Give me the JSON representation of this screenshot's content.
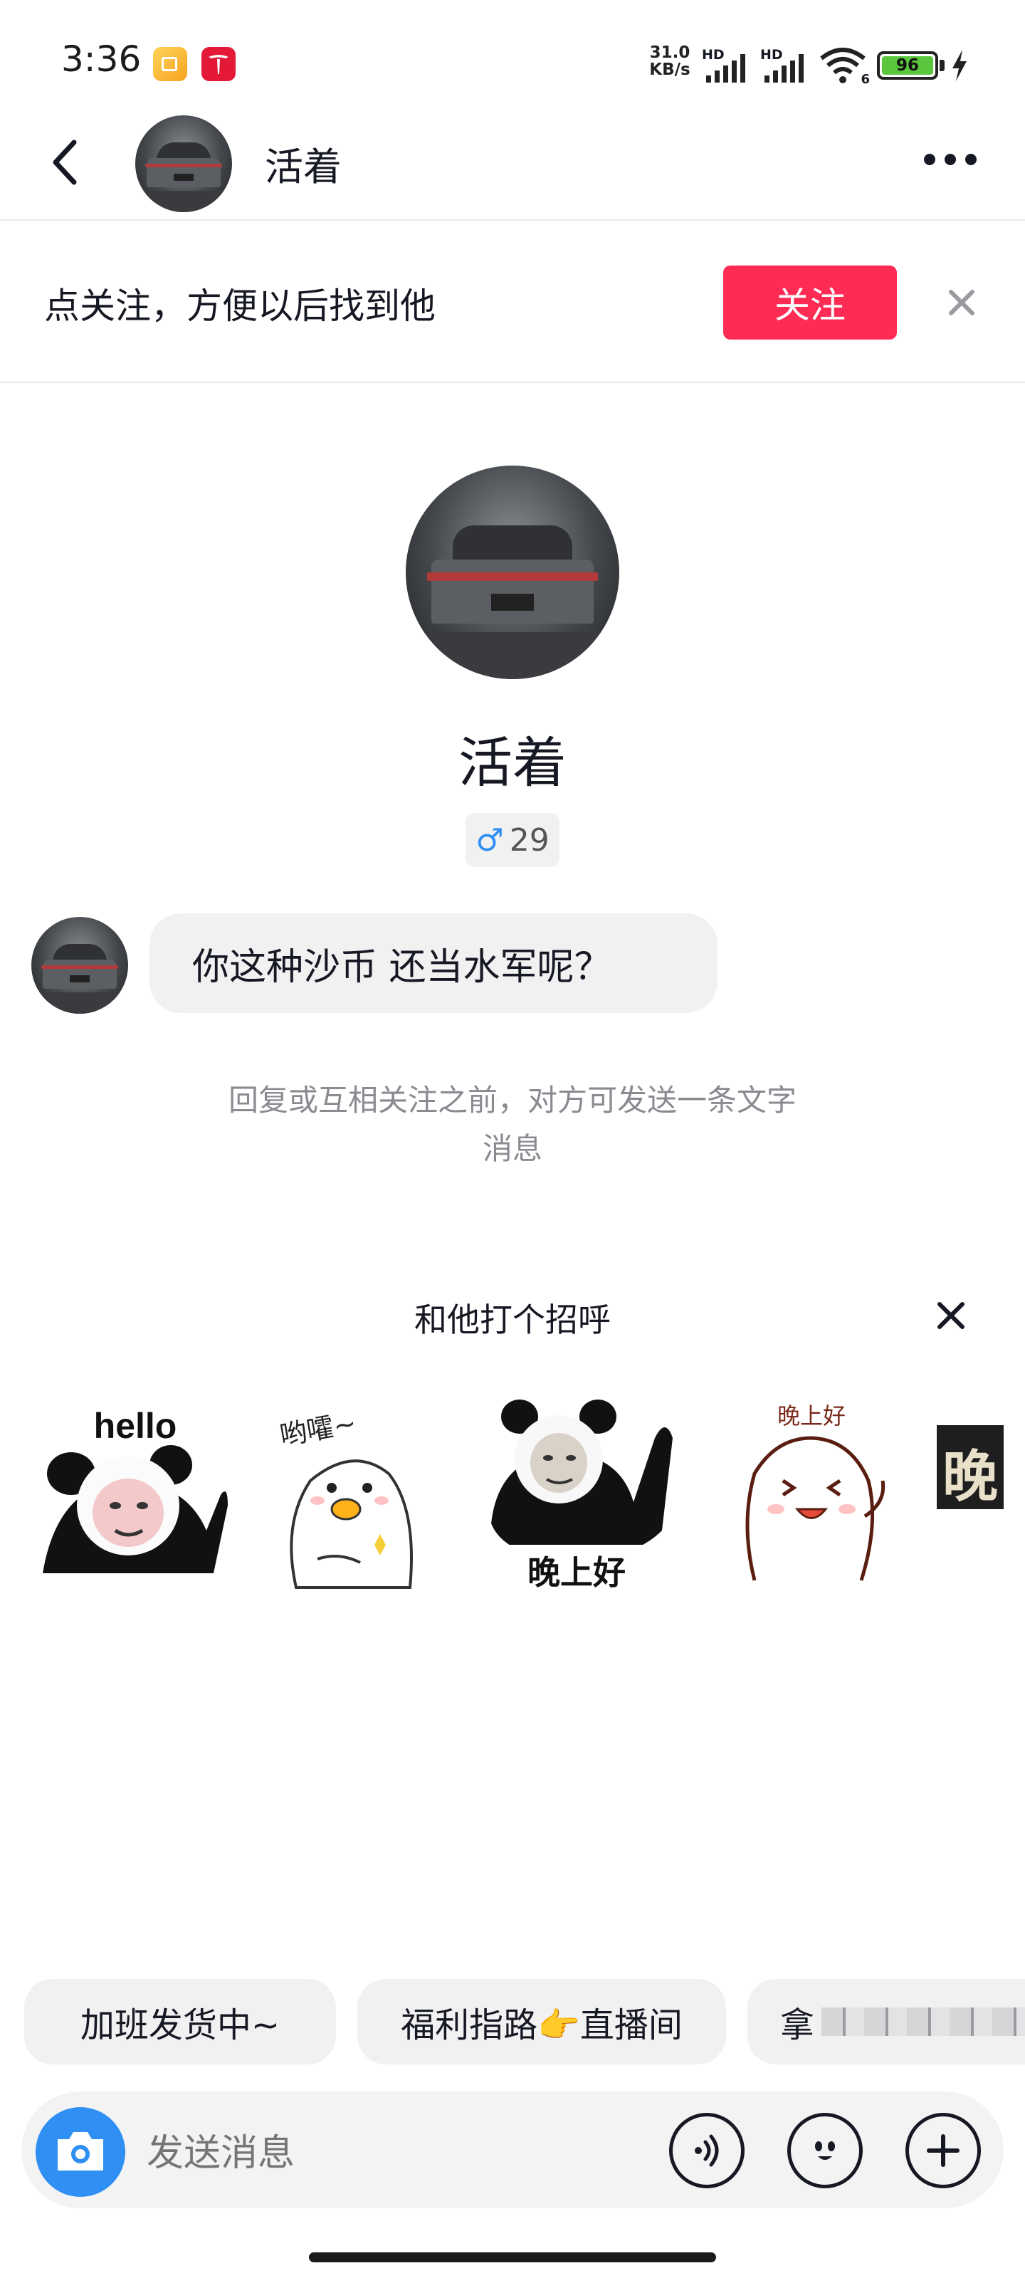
{
  "status_bar": {
    "time": "3:36",
    "net_speed_value": "31.0",
    "net_speed_unit": "KB/s",
    "signal_label_1": "HD",
    "signal_label_2": "HD",
    "wifi_label": "6",
    "battery": "96"
  },
  "header": {
    "name": "活着",
    "back_icon": "chevron-left-icon",
    "more_icon": "more-dots-icon"
  },
  "follow_banner": {
    "text": "点关注，方便以后找到他",
    "button": "关注"
  },
  "profile": {
    "name": "活着",
    "gender_symbol": "♂",
    "age": "29"
  },
  "message": {
    "text": "你这种沙币 还当水军呢？"
  },
  "notice": {
    "line1": "回复或互相关注之前，对方可发送一条文字",
    "line2": "消息"
  },
  "greeting": {
    "title": "和他打个招呼",
    "stickers": [
      {
        "caption": "hello"
      },
      {
        "caption": "哟嚯~"
      },
      {
        "caption": "晚上好"
      },
      {
        "caption": "晚上好"
      },
      {
        "caption": "晚"
      }
    ]
  },
  "quick_replies": [
    "加班发货中~",
    "福利指路👉直播间",
    "拿"
  ],
  "input": {
    "placeholder": "发送消息"
  },
  "colors": {
    "accent": "#fe2c55",
    "camera": "#2f8ff3",
    "gender": "#2f8ff3"
  }
}
